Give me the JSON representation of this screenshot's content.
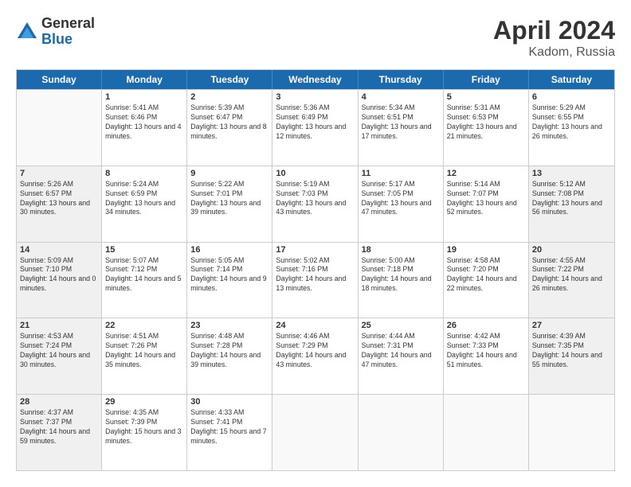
{
  "logo": {
    "general": "General",
    "blue": "Blue"
  },
  "title": {
    "month": "April 2024",
    "location": "Kadom, Russia"
  },
  "header_days": [
    "Sunday",
    "Monday",
    "Tuesday",
    "Wednesday",
    "Thursday",
    "Friday",
    "Saturday"
  ],
  "rows": [
    [
      {
        "day": "",
        "info": "",
        "empty": true
      },
      {
        "day": "1",
        "info": "Sunrise: 5:41 AM\nSunset: 6:46 PM\nDaylight: 13 hours\nand 4 minutes."
      },
      {
        "day": "2",
        "info": "Sunrise: 5:39 AM\nSunset: 6:47 PM\nDaylight: 13 hours\nand 8 minutes."
      },
      {
        "day": "3",
        "info": "Sunrise: 5:36 AM\nSunset: 6:49 PM\nDaylight: 13 hours\nand 12 minutes."
      },
      {
        "day": "4",
        "info": "Sunrise: 5:34 AM\nSunset: 6:51 PM\nDaylight: 13 hours\nand 17 minutes."
      },
      {
        "day": "5",
        "info": "Sunrise: 5:31 AM\nSunset: 6:53 PM\nDaylight: 13 hours\nand 21 minutes."
      },
      {
        "day": "6",
        "info": "Sunrise: 5:29 AM\nSunset: 6:55 PM\nDaylight: 13 hours\nand 26 minutes."
      }
    ],
    [
      {
        "day": "7",
        "info": "Sunrise: 5:26 AM\nSunset: 6:57 PM\nDaylight: 13 hours\nand 30 minutes.",
        "shaded": true
      },
      {
        "day": "8",
        "info": "Sunrise: 5:24 AM\nSunset: 6:59 PM\nDaylight: 13 hours\nand 34 minutes."
      },
      {
        "day": "9",
        "info": "Sunrise: 5:22 AM\nSunset: 7:01 PM\nDaylight: 13 hours\nand 39 minutes."
      },
      {
        "day": "10",
        "info": "Sunrise: 5:19 AM\nSunset: 7:03 PM\nDaylight: 13 hours\nand 43 minutes."
      },
      {
        "day": "11",
        "info": "Sunrise: 5:17 AM\nSunset: 7:05 PM\nDaylight: 13 hours\nand 47 minutes."
      },
      {
        "day": "12",
        "info": "Sunrise: 5:14 AM\nSunset: 7:07 PM\nDaylight: 13 hours\nand 52 minutes."
      },
      {
        "day": "13",
        "info": "Sunrise: 5:12 AM\nSunset: 7:08 PM\nDaylight: 13 hours\nand 56 minutes.",
        "shaded": true
      }
    ],
    [
      {
        "day": "14",
        "info": "Sunrise: 5:09 AM\nSunset: 7:10 PM\nDaylight: 14 hours\nand 0 minutes.",
        "shaded": true
      },
      {
        "day": "15",
        "info": "Sunrise: 5:07 AM\nSunset: 7:12 PM\nDaylight: 14 hours\nand 5 minutes."
      },
      {
        "day": "16",
        "info": "Sunrise: 5:05 AM\nSunset: 7:14 PM\nDaylight: 14 hours\nand 9 minutes."
      },
      {
        "day": "17",
        "info": "Sunrise: 5:02 AM\nSunset: 7:16 PM\nDaylight: 14 hours\nand 13 minutes."
      },
      {
        "day": "18",
        "info": "Sunrise: 5:00 AM\nSunset: 7:18 PM\nDaylight: 14 hours\nand 18 minutes."
      },
      {
        "day": "19",
        "info": "Sunrise: 4:58 AM\nSunset: 7:20 PM\nDaylight: 14 hours\nand 22 minutes."
      },
      {
        "day": "20",
        "info": "Sunrise: 4:55 AM\nSunset: 7:22 PM\nDaylight: 14 hours\nand 26 minutes.",
        "shaded": true
      }
    ],
    [
      {
        "day": "21",
        "info": "Sunrise: 4:53 AM\nSunset: 7:24 PM\nDaylight: 14 hours\nand 30 minutes.",
        "shaded": true
      },
      {
        "day": "22",
        "info": "Sunrise: 4:51 AM\nSunset: 7:26 PM\nDaylight: 14 hours\nand 35 minutes."
      },
      {
        "day": "23",
        "info": "Sunrise: 4:48 AM\nSunset: 7:28 PM\nDaylight: 14 hours\nand 39 minutes."
      },
      {
        "day": "24",
        "info": "Sunrise: 4:46 AM\nSunset: 7:29 PM\nDaylight: 14 hours\nand 43 minutes."
      },
      {
        "day": "25",
        "info": "Sunrise: 4:44 AM\nSunset: 7:31 PM\nDaylight: 14 hours\nand 47 minutes."
      },
      {
        "day": "26",
        "info": "Sunrise: 4:42 AM\nSunset: 7:33 PM\nDaylight: 14 hours\nand 51 minutes."
      },
      {
        "day": "27",
        "info": "Sunrise: 4:39 AM\nSunset: 7:35 PM\nDaylight: 14 hours\nand 55 minutes.",
        "shaded": true
      }
    ],
    [
      {
        "day": "28",
        "info": "Sunrise: 4:37 AM\nSunset: 7:37 PM\nDaylight: 14 hours\nand 59 minutes.",
        "shaded": true
      },
      {
        "day": "29",
        "info": "Sunrise: 4:35 AM\nSunset: 7:39 PM\nDaylight: 15 hours\nand 3 minutes."
      },
      {
        "day": "30",
        "info": "Sunrise: 4:33 AM\nSunset: 7:41 PM\nDaylight: 15 hours\nand 7 minutes."
      },
      {
        "day": "",
        "info": "",
        "empty": true
      },
      {
        "day": "",
        "info": "",
        "empty": true
      },
      {
        "day": "",
        "info": "",
        "empty": true
      },
      {
        "day": "",
        "info": "",
        "empty": true
      }
    ]
  ]
}
